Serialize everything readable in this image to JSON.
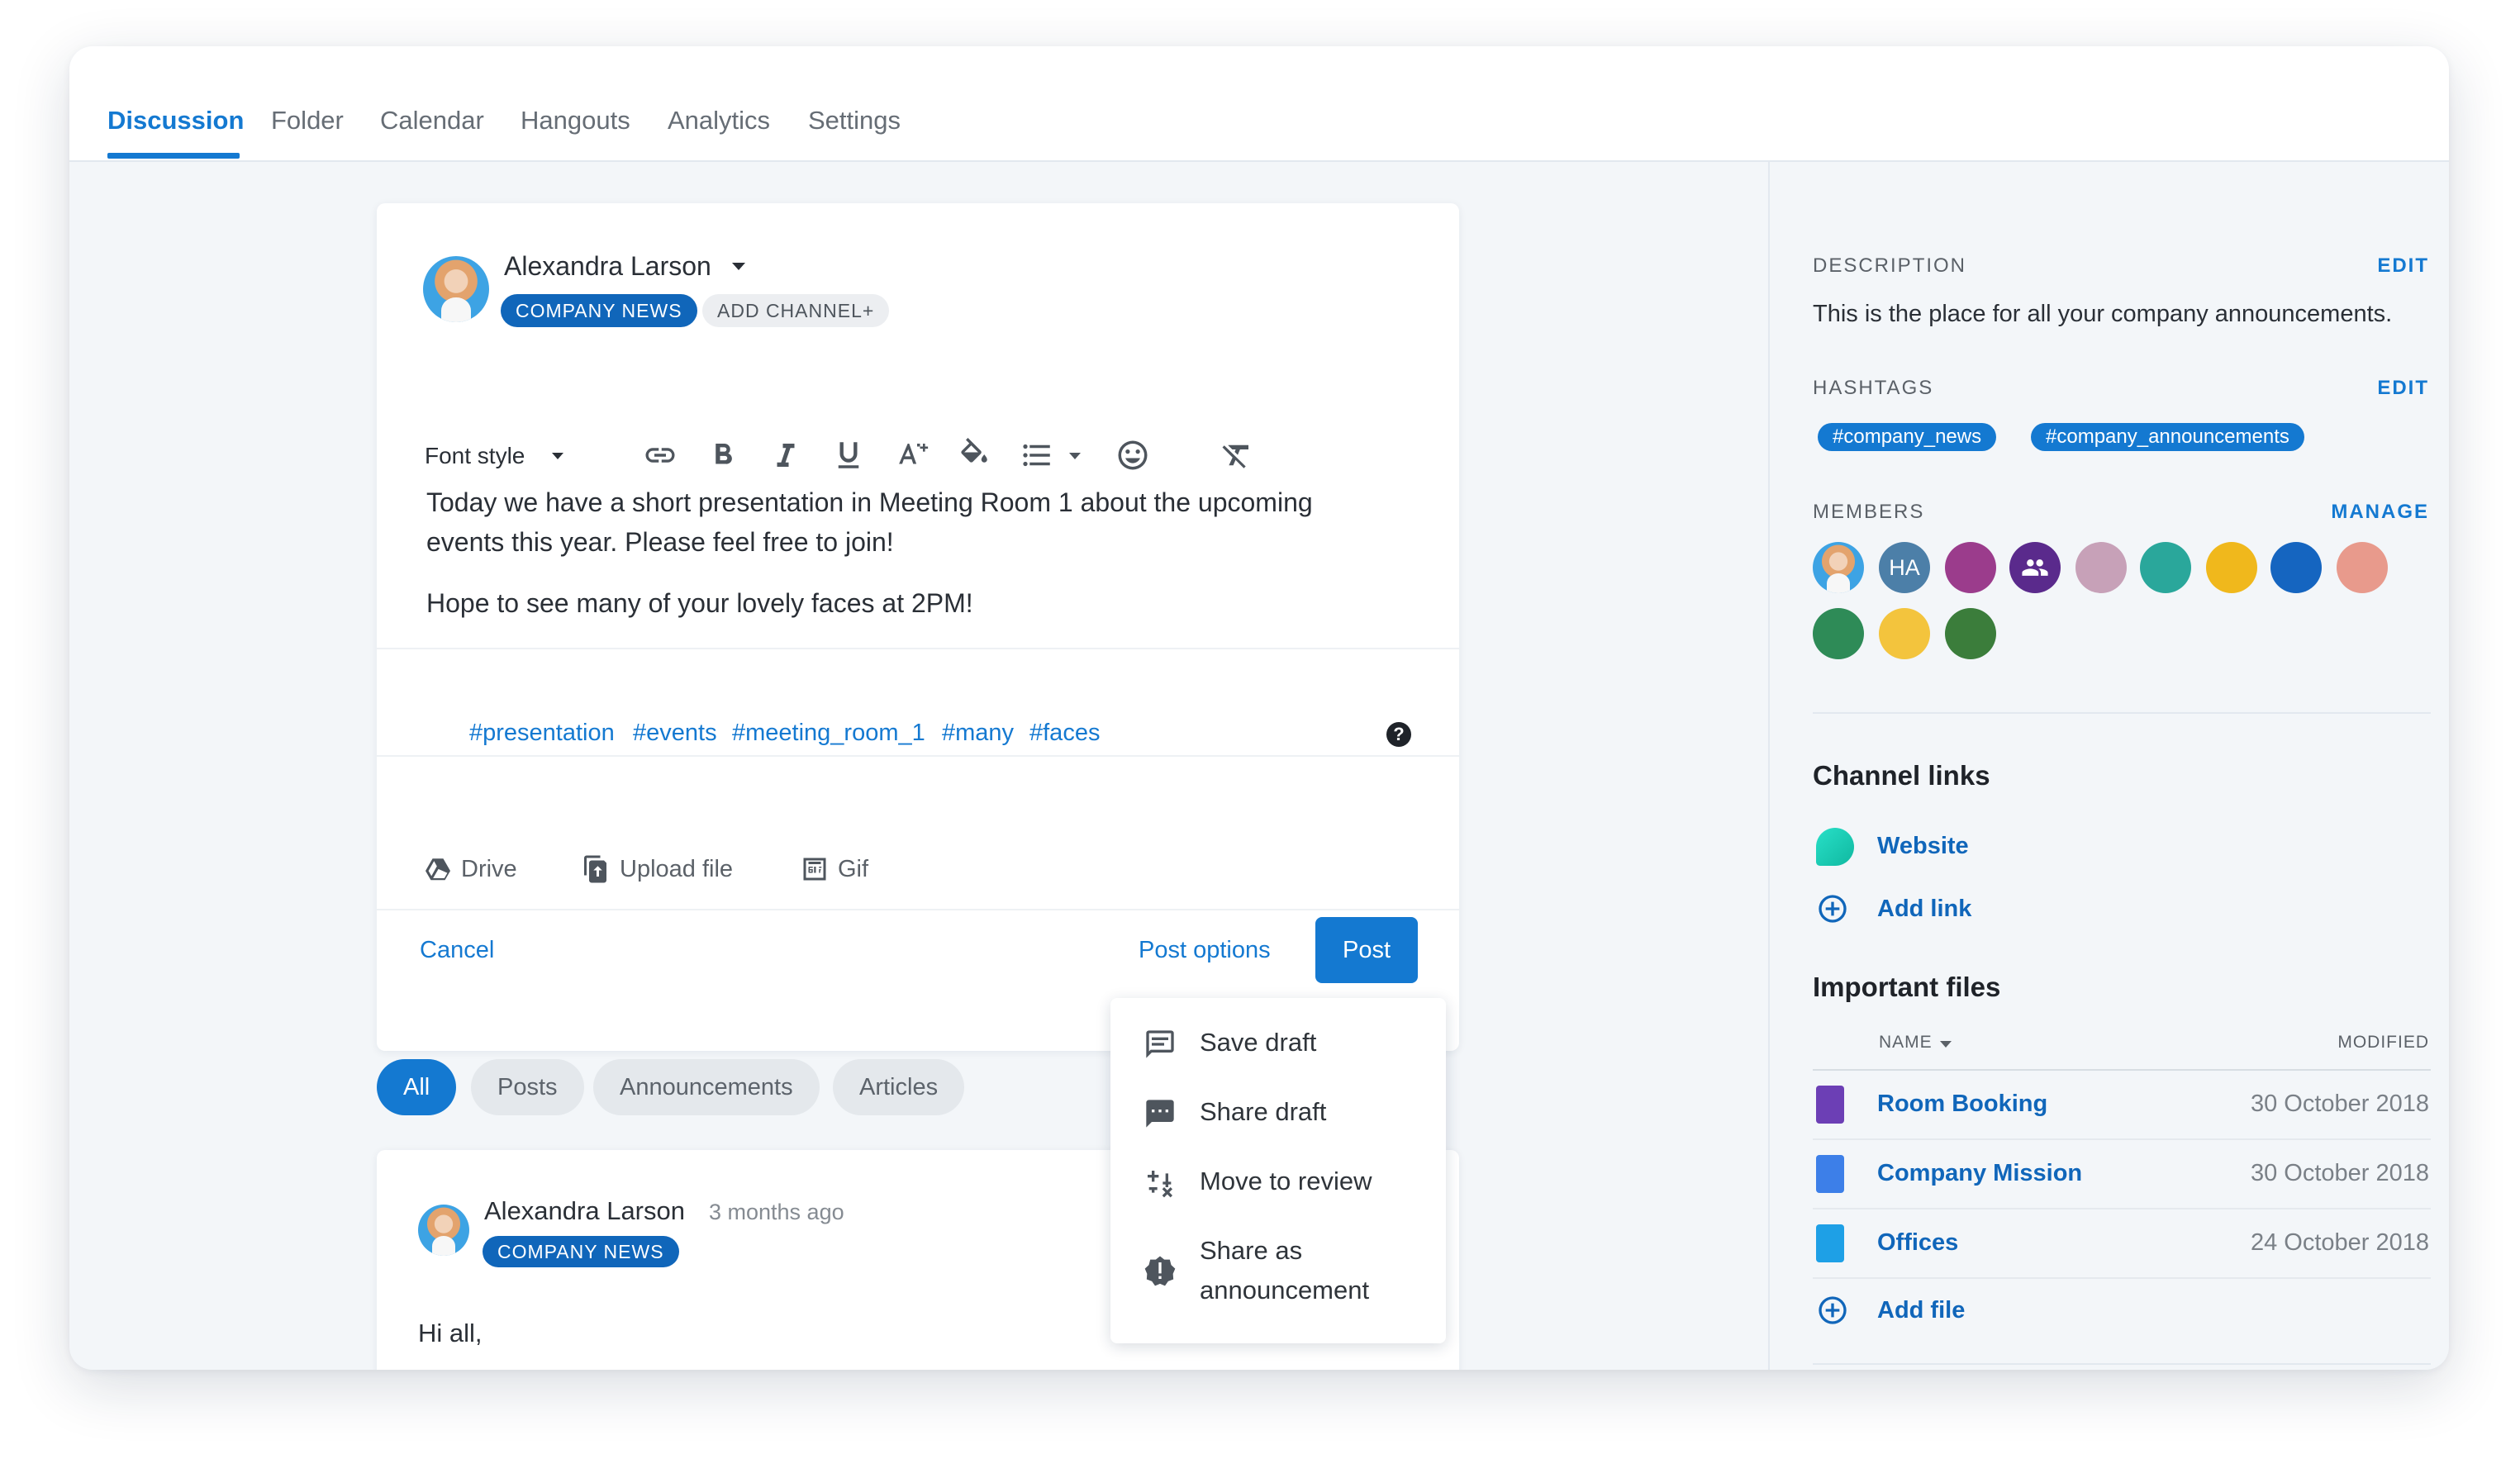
{
  "tabs": [
    "Discussion",
    "Folder",
    "Calendar",
    "Hangouts",
    "Analytics",
    "Settings"
  ],
  "composer": {
    "author": "Alexandra Larson",
    "channel": "COMPANY NEWS",
    "add_channel": "ADD CHANNEL+",
    "font_style": "Font style",
    "toolbar_icons": [
      "link-icon",
      "bold-icon",
      "italic-icon",
      "underline-icon",
      "font-size-icon",
      "fill-color-icon",
      "bulleted-list-icon",
      "emoji-icon",
      "clear-format-icon"
    ],
    "body_line1": "Today we have a short presentation in Meeting Room 1 about the upcoming",
    "body_line2": "events this year. Please feel free to join!",
    "body_line3": "Hope to see many of your lovely faces at 2PM!",
    "hashtags": [
      "#presentation",
      "#events",
      "#meeting_room_1",
      "#many",
      "#faces"
    ],
    "attach_drive": "Drive",
    "attach_upload": "Upload file",
    "attach_gif": "Gif",
    "cancel": "Cancel",
    "post_options": "Post options",
    "post": "Post"
  },
  "post_menu": {
    "save_draft": "Save draft",
    "share_draft": "Share draft",
    "move_to_review": "Move to review",
    "share_as_line1": "Share as",
    "share_as_line2": "announcement"
  },
  "filters": [
    "All",
    "Posts",
    "Announcements",
    "Articles"
  ],
  "feed_post": {
    "author": "Alexandra Larson",
    "time": "3 months ago",
    "channel": "COMPANY NEWS",
    "text": "Hi all,"
  },
  "sidebar": {
    "description_label": "DESCRIPTION",
    "description_edit": "EDIT",
    "description": "This is the place for all your company announcements.",
    "hashtags_label": "HASHTAGS",
    "hashtags_edit": "EDIT",
    "hashtags": [
      "#company_news",
      "#company_announcements"
    ],
    "members_label": "MEMBERS",
    "members_manage": "MANAGE",
    "member_initials": "HA",
    "channel_links_title": "Channel links",
    "website": "Website",
    "add_link": "Add link",
    "files_title": "Important files",
    "col_name": "NAME",
    "col_modified": "MODIFIED",
    "files": [
      {
        "name": "Room Booking",
        "modified": "30 October 2018"
      },
      {
        "name": "Company Mission",
        "modified": "30 October 2018"
      },
      {
        "name": "Offices",
        "modified": "24 October 2018"
      }
    ],
    "add_file": "Add file"
  },
  "colors": {
    "accent": "#1479d1",
    "channel_pill": "#1066ba",
    "background": "#f3f6f9"
  }
}
